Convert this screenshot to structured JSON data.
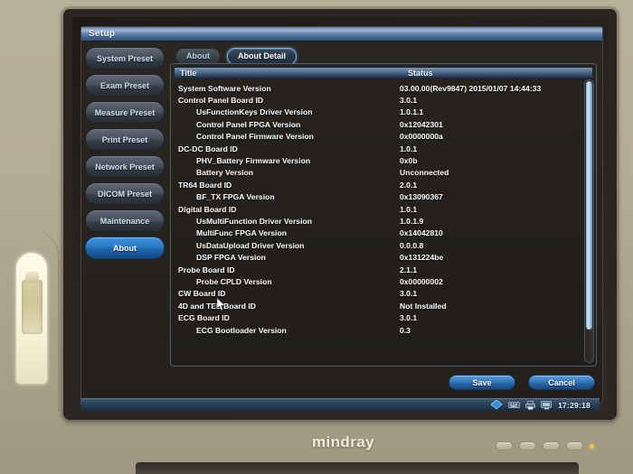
{
  "window": {
    "title": "Setup"
  },
  "sidebar": {
    "items": [
      {
        "label": "System Preset",
        "active": false
      },
      {
        "label": "Exam Preset",
        "active": false
      },
      {
        "label": "Measure Preset",
        "active": false
      },
      {
        "label": "Print Preset",
        "active": false
      },
      {
        "label": "Network Preset",
        "active": false
      },
      {
        "label": "DICOM Preset",
        "active": false
      },
      {
        "label": "Maintenance",
        "active": false
      },
      {
        "label": "About",
        "active": true
      }
    ]
  },
  "tabs": [
    {
      "label": "About",
      "active": false
    },
    {
      "label": "About Detail",
      "active": true
    }
  ],
  "table": {
    "columns": {
      "title": "Title",
      "status": "Status"
    },
    "rows": [
      {
        "indent": 0,
        "title": "System Software Version",
        "status": "03.00.00(Rev9847) 2015/01/07 14:44:33"
      },
      {
        "indent": 0,
        "title": "Control Panel Board ID",
        "status": "3.0.1"
      },
      {
        "indent": 1,
        "title": "UsFunctionKeys Driver Version",
        "status": "1.0.1.1"
      },
      {
        "indent": 1,
        "title": "Control Panel FPGA Version",
        "status": "0x12042301"
      },
      {
        "indent": 1,
        "title": "Control Panel Firmware Version",
        "status": "0x0000000a"
      },
      {
        "indent": 0,
        "title": "DC-DC Board ID",
        "status": "1.0.1"
      },
      {
        "indent": 1,
        "title": "PHV_Battery Firmware Version",
        "status": "0x0b"
      },
      {
        "indent": 1,
        "title": "Battery Version",
        "status": "Unconnected"
      },
      {
        "indent": 0,
        "title": "TR64 Board ID",
        "status": "2.0.1"
      },
      {
        "indent": 1,
        "title": "BF_TX FPGA Version",
        "status": "0x13090367"
      },
      {
        "indent": 0,
        "title": "Digital Board ID",
        "status": "1.0.1"
      },
      {
        "indent": 1,
        "title": "UsMultiFunction Driver Version",
        "status": "1.0.1.9"
      },
      {
        "indent": 1,
        "title": "MultiFunc FPGA Version",
        "status": "0x14042810"
      },
      {
        "indent": 1,
        "title": "UsDataUpload Driver Version",
        "status": "0.0.0.8"
      },
      {
        "indent": 1,
        "title": "DSP FPGA Version",
        "status": "0x131224be"
      },
      {
        "indent": 0,
        "title": "Probe Board ID",
        "status": "2.1.1"
      },
      {
        "indent": 1,
        "title": "Probe CPLD Version",
        "status": "0x00000002"
      },
      {
        "indent": 0,
        "title": "CW Board ID",
        "status": "3.0.1"
      },
      {
        "indent": 0,
        "title": "4D and TEE Board ID",
        "status": "Not Installed"
      },
      {
        "indent": 0,
        "title": "ECG Board ID",
        "status": "3.0.1"
      },
      {
        "indent": 1,
        "title": "ECG Bootloader Version",
        "status": "0.3"
      }
    ]
  },
  "footer": {
    "save_label": "Save",
    "cancel_label": "Cancel"
  },
  "status_bar": {
    "time": "17:29:18",
    "icons": [
      "pointer-icon",
      "keyboard-icon",
      "printer-icon",
      "monitor-icon"
    ]
  },
  "device": {
    "brand": "mindray"
  },
  "colors": {
    "accent_blue": "#2a78c4",
    "tab_highlight": "#6fb6ef",
    "title_bar": "#5a7ea9",
    "panel_bg": "#231f1c",
    "text_primary": "#ffffff",
    "bezel": "#b5ac96"
  }
}
